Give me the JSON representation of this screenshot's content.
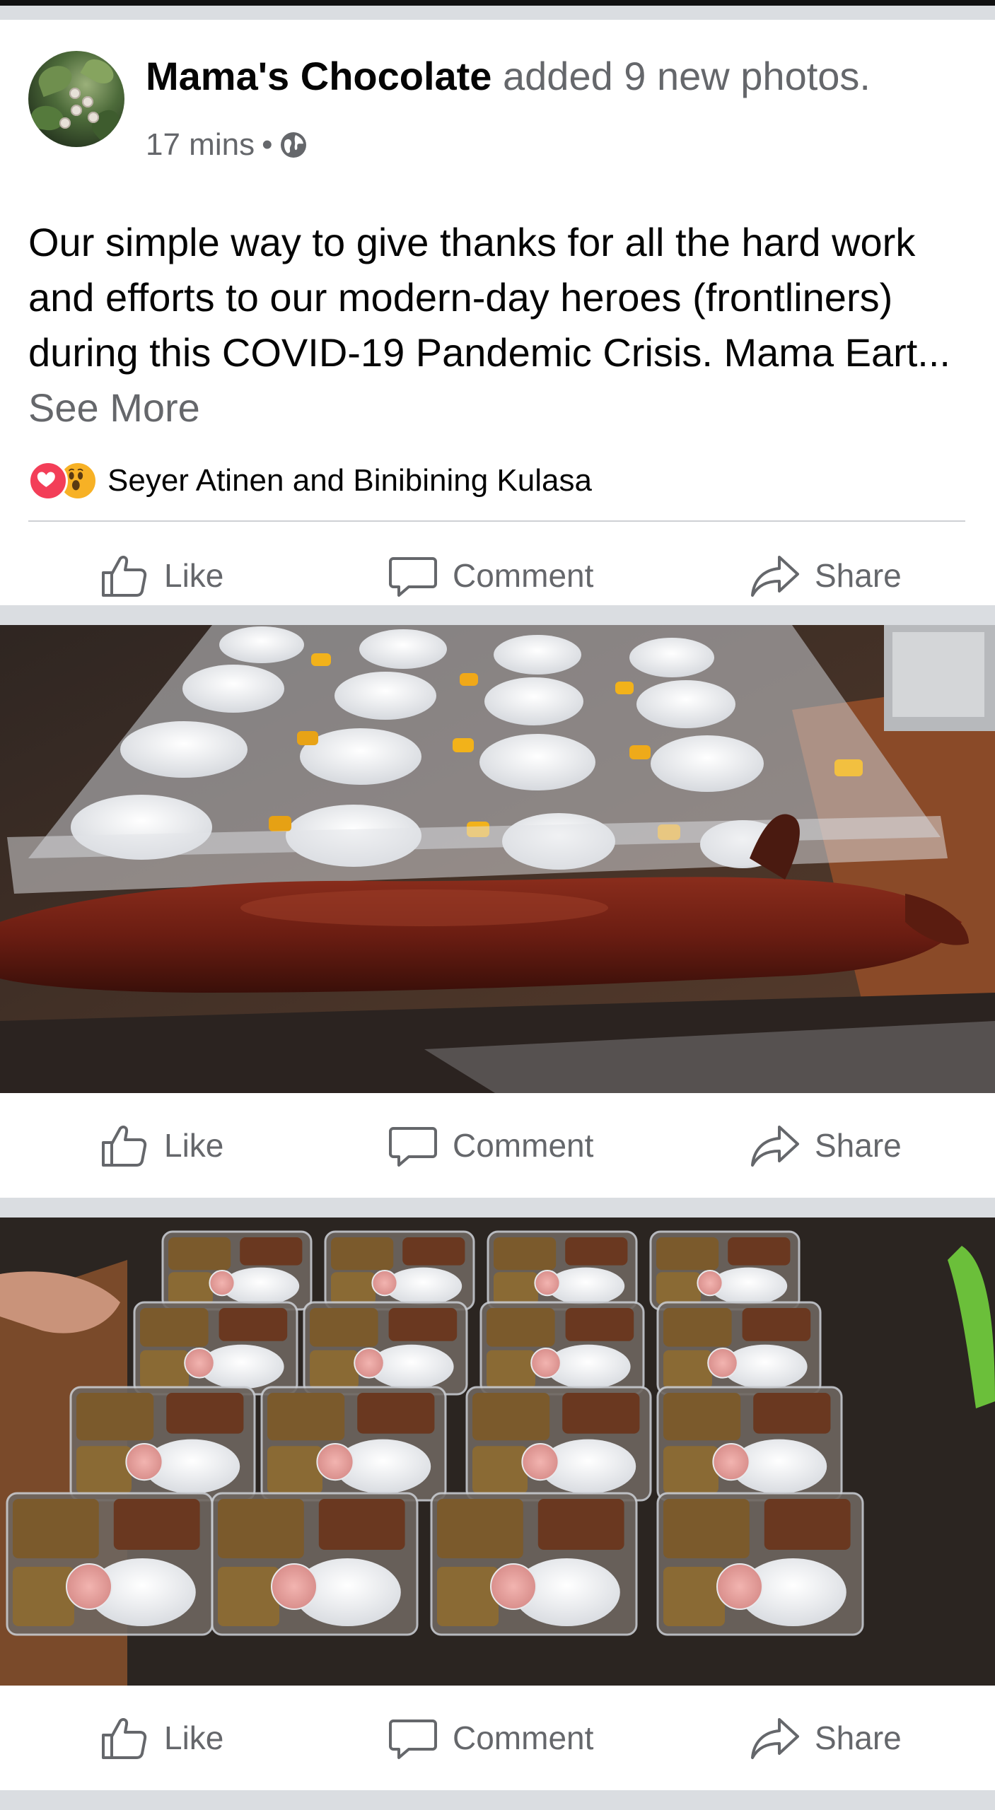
{
  "post": {
    "page_name": "Mama's Chocolate",
    "action_text": "added 9 new photos.",
    "timestamp": "17 mins",
    "separator": "•",
    "privacy_icon": "globe-icon",
    "text": "Our simple way to give thanks for all the hard work and efforts to our modern-day heroes (frontliners) during this COVID-19 Pandemic Crisis. Mama Eart...",
    "see_more": "See More",
    "reactions": {
      "icons": [
        "love-icon",
        "wow-icon"
      ],
      "names": "Seyer Atinen and Binibining Kulasa"
    }
  },
  "actions": {
    "like": "Like",
    "comment": "Comment",
    "share": "Share"
  },
  "colors": {
    "text_primary": "#050505",
    "text_secondary": "#65676b",
    "divider": "#ced0d4",
    "background_gap": "#dadde1",
    "love": "#f33e58",
    "wow": "#f7b125"
  }
}
